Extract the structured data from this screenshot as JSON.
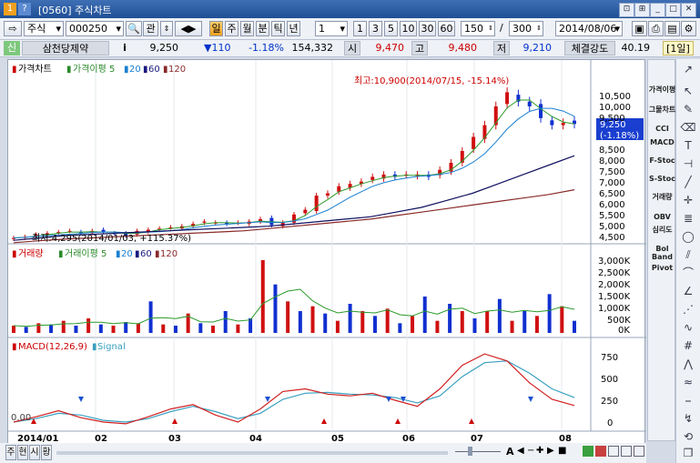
{
  "window": {
    "number_icon": "1",
    "help_icon": "?",
    "title": "[0560] 주식차트"
  },
  "toolbar": {
    "market": "주식",
    "code": "000250",
    "btn_gwan": "관",
    "period_btns": [
      "일",
      "주",
      "월",
      "분",
      "틱",
      "년"
    ],
    "interval_select": "1",
    "minute_btns": [
      "1",
      "3",
      "5",
      "10",
      "30",
      "60"
    ],
    "count_value": "150",
    "count_total": "/",
    "count_max": "300",
    "date": "2014/08/06"
  },
  "infobar": {
    "tag": "신",
    "name": "삼천당제약",
    "info_icon": "i",
    "price": "9,250",
    "change": "▼110",
    "change_pct": "-1.18%",
    "volume": "154,332",
    "open_label": "시",
    "open": "9,470",
    "high_label": "고",
    "high": "9,480",
    "low_label": "저",
    "low": "9,210",
    "strength_label": "체결강도",
    "strength": "40.19",
    "period_tag": "[1일]"
  },
  "price_panel": {
    "legend": [
      "가격차트",
      "가격이평 5",
      "20",
      "60",
      "120"
    ],
    "high_note": "최고:10,900(2014/07/15, -15.14%)",
    "low_note": "최저:4,295(2014/01/03, +115.37%)",
    "y_labels": [
      "10,500",
      "10,000",
      "9,500",
      "9,000",
      "8,500",
      "8,000",
      "7,500",
      "7,000",
      "6,500",
      "6,000",
      "5,500",
      "5,000",
      "4,500"
    ],
    "current_price": "9,250",
    "current_change": "(-1.18%)"
  },
  "volume_panel": {
    "legend": [
      "거래량",
      "거래이평 5",
      "20",
      "60",
      "120"
    ],
    "y_labels": [
      "3,000K",
      "2,500K",
      "2,000K",
      "1,500K",
      "1,000K",
      "500K",
      "0K"
    ]
  },
  "macd_panel": {
    "legend": [
      "MACD(12,26,9)",
      "Signal"
    ],
    "y_labels": [
      "750",
      "500",
      "250",
      "0"
    ],
    "zero_label": "0.00"
  },
  "x_axis": [
    "2014/01",
    "02",
    "03",
    "04",
    "05",
    "06",
    "07",
    "08"
  ],
  "indicators": [
    "가격이평",
    "그물차트",
    "CCI",
    "MACD",
    "F-Stoc",
    "S-Stoc",
    "거래량",
    "OBV",
    "심리도",
    "Bol Band",
    "Pivot"
  ],
  "bottom_tabs": [
    "주",
    "현",
    "시",
    "황"
  ],
  "chart_data": {
    "type": "candlestick",
    "x_range": [
      "2014/01/02",
      "2014/08/06"
    ],
    "ylim": [
      4000,
      11000
    ],
    "high": {
      "value": 10900,
      "date": "2014/07/15"
    },
    "low": {
      "value": 4295,
      "date": "2014/01/03"
    },
    "close_series": [
      4400,
      4450,
      4550,
      4600,
      4650,
      4700,
      4600,
      4700,
      4650,
      4600,
      4500,
      4700,
      4750,
      4800,
      4850,
      4900,
      5000,
      5100,
      5050,
      5000,
      5050,
      5100,
      5200,
      4950,
      5050,
      5400,
      5600,
      6200,
      6300,
      6600,
      6700,
      6800,
      7000,
      7100,
      7000,
      7100,
      7100,
      7000,
      7300,
      7600,
      8100,
      8700,
      9200,
      10000,
      10600,
      10200,
      10000,
      9500,
      9200,
      9300,
      9250
    ],
    "ma60": [
      4300,
      4400,
      4500,
      4550,
      4600,
      4650,
      4700,
      4750,
      4800,
      4850,
      4900,
      5000,
      5100,
      5200,
      5300,
      5500,
      5700,
      6000,
      6300,
      6700,
      7100,
      7500,
      7900
    ],
    "ma120": [
      4200,
      4280,
      4350,
      4400,
      4450,
      4500,
      4550,
      4600,
      4650,
      4700,
      4800,
      4900,
      5000,
      5100,
      5200,
      5350,
      5500,
      5650,
      5800,
      5950,
      6100,
      6250,
      6450
    ],
    "volume_K": [
      300,
      250,
      400,
      350,
      500,
      300,
      600,
      350,
      300,
      450,
      400,
      1300,
      350,
      300,
      800,
      400,
      300,
      900,
      350,
      600,
      3000,
      2000,
      1300,
      900,
      1100,
      800,
      500,
      1200,
      900,
      700,
      1000,
      400,
      700,
      1500,
      500,
      1200,
      900,
      600,
      900,
      1400,
      500,
      900,
      700,
      1600,
      1100,
      500
    ],
    "macd": [
      0,
      60,
      130,
      50,
      0,
      -20,
      60,
      150,
      200,
      80,
      0,
      150,
      350,
      380,
      320,
      300,
      330,
      250,
      180,
      380,
      650,
      780,
      700,
      450,
      260,
      190
    ],
    "signal": [
      0,
      40,
      100,
      80,
      20,
      0,
      40,
      120,
      180,
      120,
      40,
      100,
      260,
      330,
      340,
      320,
      310,
      280,
      220,
      300,
      520,
      680,
      700,
      560,
      380,
      280
    ]
  }
}
